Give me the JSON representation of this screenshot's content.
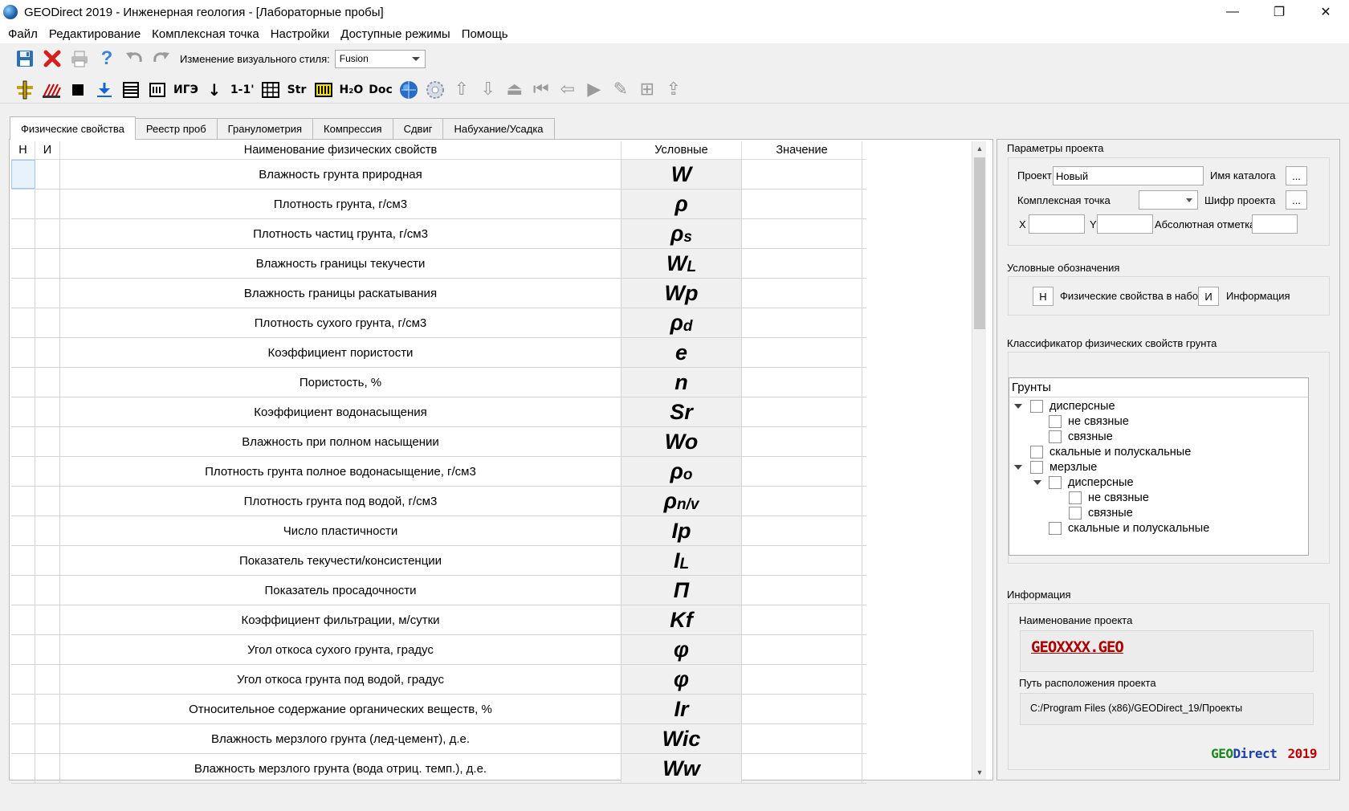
{
  "window": {
    "title": "GEODirect 2019 - Инженерная геология - [Лабораторные пробы]",
    "minimize": "—",
    "maximize": "❐",
    "close": "✕"
  },
  "menu": {
    "file": "Файл",
    "edit": "Редактирование",
    "complex_point": "Комплексная точка",
    "settings": "Настройки",
    "modes": "Доступные режимы",
    "help": "Помощь"
  },
  "toolbar1": {
    "style_label": "Изменение визуального стиля:",
    "style_value": "Fusion"
  },
  "toolbar2": {
    "igz": "ИГЭ",
    "oneone": "1-1'",
    "str": "Str",
    "h2o": "H₂O",
    "doc": "Doc"
  },
  "tabs": [
    "Физические свойства",
    "Реестр проб",
    "Гранулометрия",
    "Компрессия",
    "Сдвиг",
    "Набухание/Усадка"
  ],
  "grid": {
    "headers": {
      "n": "Н",
      "i": "И",
      "name": "Наименование физических свойств",
      "symbol": "Условные",
      "value": "Значение"
    },
    "rows": [
      {
        "name": "Влажность грунта природная",
        "sym": "W",
        "sub": ""
      },
      {
        "name": "Плотность грунта, г/см3",
        "sym": "ρ",
        "sub": ""
      },
      {
        "name": "Плотность частиц грунта, г/см3",
        "sym": "ρ",
        "sub": "s"
      },
      {
        "name": "Влажность границы текучести",
        "sym": "W",
        "sub": "L"
      },
      {
        "name": "Влажность границы раскатывания",
        "sym": "Wp",
        "sub": ""
      },
      {
        "name": "Плотность сухого грунта, г/см3",
        "sym": "ρ",
        "sub": "d"
      },
      {
        "name": "Коэффициент пористости",
        "sym": "e",
        "sub": ""
      },
      {
        "name": "Пористость, %",
        "sym": "n",
        "sub": ""
      },
      {
        "name": "Коэффициент водонасыщения",
        "sym": "Sr",
        "sub": ""
      },
      {
        "name": "Влажность при полном насыщении",
        "sym": "Wo",
        "sub": ""
      },
      {
        "name": "Плотность грунта полное водонасыщение, г/см3",
        "sym": "ρ",
        "sub": "o"
      },
      {
        "name": "Плотность грунта под водой, г/см3",
        "sym": "ρ",
        "sub": "n/v"
      },
      {
        "name": "Число пластичности",
        "sym": "Ip",
        "sub": ""
      },
      {
        "name": "Показатель текучести/консистенции",
        "sym": "I",
        "sub": "L"
      },
      {
        "name": "Показатель просадочности",
        "sym": "П",
        "sub": ""
      },
      {
        "name": "Коэффициент фильтрации, м/сутки",
        "sym": "Kf",
        "sub": ""
      },
      {
        "name": "Угол откоса сухого грунта, градус",
        "sym": "φ",
        "sub": ""
      },
      {
        "name": "Угол откоса грунта под водой, градус",
        "sym": "φ",
        "sub": ""
      },
      {
        "name": "Относительное содержание органических веществ, %",
        "sym": "Ir",
        "sub": ""
      },
      {
        "name": "Влажность мерзлого грунта (лед-цемент), д.е.",
        "sym": "Wic",
        "sub": ""
      },
      {
        "name": "Влажность мерзлого грунта (вода отриц. темп.), д.е.",
        "sym": "Ww",
        "sub": ""
      }
    ]
  },
  "params": {
    "title": "Параметры проекта",
    "project_label": "Проект",
    "project_value": "Новый",
    "catalog_label": "Имя каталога",
    "browse": "...",
    "complex_label": "Комплексная точка",
    "cipher_label": "Шифр проекта",
    "x_label": "X",
    "y_label": "Y",
    "abs_label": "Абсолютная отметка"
  },
  "legend": {
    "title": "Условные обозначения",
    "n_btn": "Н",
    "n_text": "Физические свойства в набор",
    "i_btn": "И",
    "i_text": "Информация"
  },
  "classifier": {
    "title": "Классификатор физических свойств грунта",
    "header": "Грунты",
    "items": [
      "дисперсные",
      "не связные",
      "связные",
      "скальные и полускальные",
      "мерзлые",
      "дисперсные",
      "не связные",
      "связные",
      "скальные и полускальные"
    ]
  },
  "info": {
    "title": "Информация",
    "name_label": "Наименование проекта",
    "name_value": "GEOXXXX.GEO",
    "path_label": "Путь расположения проекта",
    "path_value": "C:/Program Files (x86)/GEODirect_19/Проекты",
    "logo_geo": "GEO",
    "logo_direct": "Direct",
    "logo_year": "2019"
  },
  "colors": {
    "logo_geo": "#1a8a1a",
    "logo_direct": "#1a3fb0",
    "logo_year": "#c00000",
    "project_name": "#a00000"
  }
}
